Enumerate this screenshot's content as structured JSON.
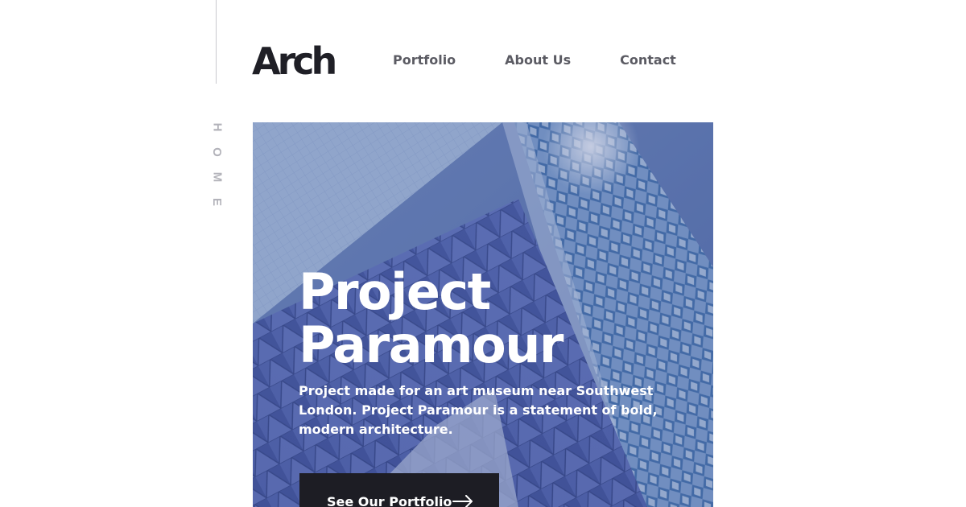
{
  "brand": {
    "logo": "Arch"
  },
  "nav": {
    "items": [
      {
        "label": "Portfolio"
      },
      {
        "label": "About Us"
      },
      {
        "label": "Contact"
      }
    ]
  },
  "side_label": {
    "letters": [
      "H",
      "O",
      "M",
      "E"
    ]
  },
  "hero": {
    "title_line1": "Project",
    "title_line2": "Paramour",
    "description": "Project made for an art museum near Southwest London. Project Paramour is a statement of bold, modern architecture.",
    "cta_label": "See Our Portfolio"
  },
  "icons": {
    "cta": "arrow-right-icon"
  },
  "colors": {
    "logo": "#1f1f26",
    "nav_text": "#5b5b63",
    "side_label": "#b3b3ba",
    "cta_bg": "#1d1d24",
    "hero_overlay": "#4f62a0"
  }
}
